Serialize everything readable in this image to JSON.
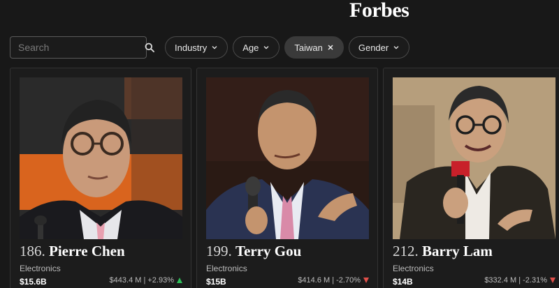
{
  "header": {
    "logo": "Forbes"
  },
  "search": {
    "placeholder": "Search",
    "value": ""
  },
  "filters": [
    {
      "label": "Industry",
      "type": "dropdown"
    },
    {
      "label": "Age",
      "type": "dropdown"
    },
    {
      "label": "Taiwan",
      "type": "active"
    },
    {
      "label": "Gender",
      "type": "dropdown"
    }
  ],
  "cards": [
    {
      "rank": "186.",
      "name": "Pierre Chen",
      "industry": "Electronics",
      "net_worth": "$15.6B",
      "change": "$443.4 M | +2.93%",
      "direction": "up"
    },
    {
      "rank": "199.",
      "name": "Terry Gou",
      "industry": "Electronics",
      "net_worth": "$15B",
      "change": "$414.6 M | -2.70%",
      "direction": "down"
    },
    {
      "rank": "212.",
      "name": "Barry Lam",
      "industry": "Electronics",
      "net_worth": "$14B",
      "change": "$332.4 M | -2.31%",
      "direction": "down"
    }
  ],
  "colors": {
    "background": "#181818",
    "up": "#2ec05a",
    "down": "#e0504a"
  }
}
